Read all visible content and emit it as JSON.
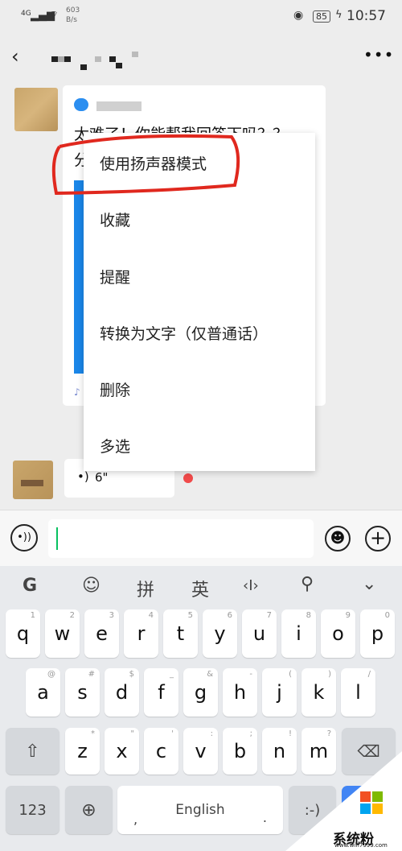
{
  "status": {
    "network": "4G",
    "speed": "603",
    "speed_unit": "B/s",
    "battery": "85",
    "time": "10:57"
  },
  "header": {
    "back": "back",
    "more": "more"
  },
  "messages": [
    {
      "type": "shared",
      "text_line1": "太难了！你能帮我回答下吗？？",
      "text_line2": "分"
    },
    {
      "type": "voice",
      "duration": "6\""
    }
  ],
  "context_menu": {
    "items": [
      "使用扬声器模式",
      "收藏",
      "提醒",
      "转换为文字（仅普通话）",
      "删除",
      "多选"
    ],
    "highlighted": 0,
    "highlight_color": "#e0281e"
  },
  "input": {
    "value": ""
  },
  "keyboard": {
    "toolbar": [
      "G",
      "☺",
      "拼",
      "英",
      "‹I›",
      "search",
      "down"
    ],
    "row1": [
      [
        "q",
        "1"
      ],
      [
        "w",
        "2"
      ],
      [
        "e",
        "3"
      ],
      [
        "r",
        "4"
      ],
      [
        "t",
        "5"
      ],
      [
        "y",
        "6"
      ],
      [
        "u",
        "7"
      ],
      [
        "i",
        "8"
      ],
      [
        "o",
        "9"
      ],
      [
        "p",
        "0"
      ]
    ],
    "row2": [
      [
        "a",
        "@"
      ],
      [
        "s",
        "#"
      ],
      [
        "d",
        "$"
      ],
      [
        "f",
        "_"
      ],
      [
        "g",
        "&"
      ],
      [
        "h",
        "-"
      ],
      [
        "j",
        "("
      ],
      [
        "k",
        ")"
      ],
      [
        "l",
        "/"
      ]
    ],
    "row3": [
      [
        "z",
        "*"
      ],
      [
        "x",
        "\""
      ],
      [
        "c",
        "'"
      ],
      [
        "v",
        ":"
      ],
      [
        "b",
        ";"
      ],
      [
        "n",
        "!"
      ],
      [
        "m",
        "?"
      ]
    ],
    "num_label": "123",
    "space_label": "English",
    "comma": ",",
    "period": ".",
    "emoticon": ":-)"
  },
  "watermark": {
    "text": "系统粉",
    "url": "www.win7999.com"
  }
}
